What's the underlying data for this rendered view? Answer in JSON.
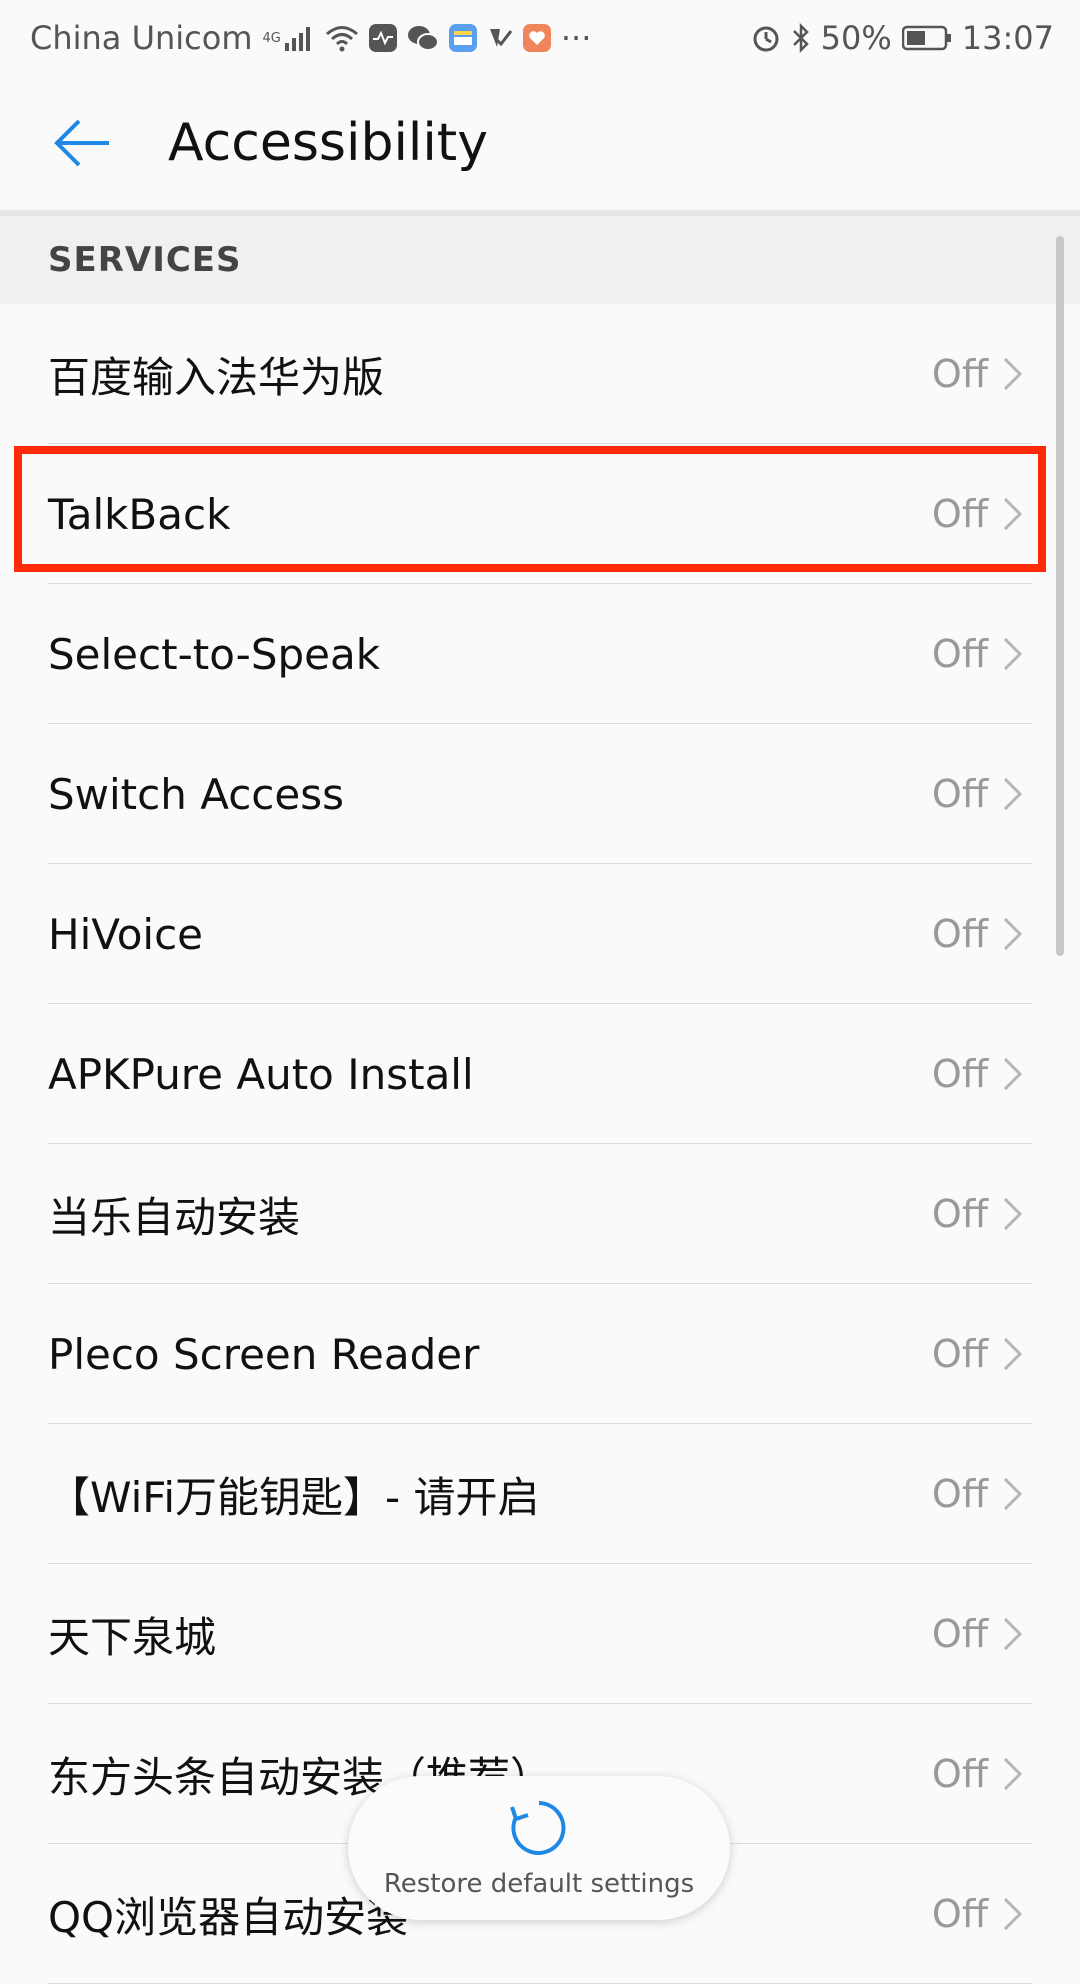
{
  "status_bar": {
    "carrier": "China Unicom",
    "network": "4G",
    "battery_percent": "50%",
    "time": "13:07",
    "more": "···",
    "icons": [
      "signal-icon",
      "wifi-icon",
      "activity-icon",
      "wechat-icon",
      "wallet-icon",
      "task-icon",
      "health-icon",
      "alarm-icon",
      "bluetooth-icon",
      "battery-icon"
    ]
  },
  "header": {
    "title": "Accessibility",
    "back_icon": "back-arrow-icon",
    "accent": "#1e88e5"
  },
  "section": {
    "title": "SERVICES"
  },
  "services": [
    {
      "label": "百度输入法华为版",
      "value": "Off"
    },
    {
      "label": "TalkBack",
      "value": "Off"
    },
    {
      "label": "Select-to-Speak",
      "value": "Off"
    },
    {
      "label": "Switch Access",
      "value": "Off"
    },
    {
      "label": "HiVoice",
      "value": "Off"
    },
    {
      "label": "APKPure Auto Install",
      "value": "Off"
    },
    {
      "label": "当乐自动安装",
      "value": "Off"
    },
    {
      "label": "Pleco Screen Reader",
      "value": "Off"
    },
    {
      "label": "【WiFi万能钥匙】- 请开启",
      "value": "Off"
    },
    {
      "label": "天下泉城",
      "value": "Off"
    },
    {
      "label": "东方头条自动安装（推荐）",
      "value": "Off"
    },
    {
      "label": "QQ浏览器自动安装",
      "value": "Off"
    }
  ],
  "highlight": {
    "target": "TalkBack",
    "color": "#ff2a0a"
  },
  "restore": {
    "label": "Restore default settings",
    "icon": "restore-icon"
  }
}
